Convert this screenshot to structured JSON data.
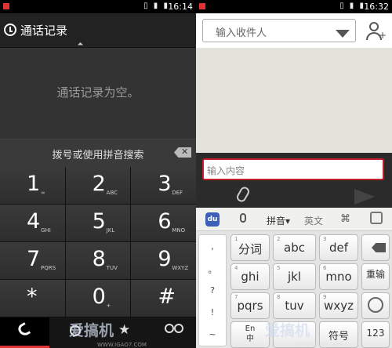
{
  "left": {
    "status_time": "16:14",
    "header_title": "通话记录",
    "empty_text": "通话记录为空。",
    "search_hint": "拨号或使用拼音搜索",
    "keys": [
      {
        "digit": "1",
        "letters": "∞"
      },
      {
        "digit": "2",
        "letters": "ABC"
      },
      {
        "digit": "3",
        "letters": "DEF"
      },
      {
        "digit": "4",
        "letters": "GHI"
      },
      {
        "digit": "5",
        "letters": "JKL"
      },
      {
        "digit": "6",
        "letters": "MNO"
      },
      {
        "digit": "7",
        "letters": "PQRS"
      },
      {
        "digit": "8",
        "letters": "TUV"
      },
      {
        "digit": "9",
        "letters": "WXYZ"
      },
      {
        "digit": "*",
        "letters": ""
      },
      {
        "digit": "0",
        "letters": "+"
      },
      {
        "digit": "#",
        "letters": ""
      }
    ],
    "backspace_symbol": "✕",
    "watermark": "爱搞机",
    "watermark_url": "WWW.IGAO7.COM"
  },
  "right": {
    "status_time": "16:32",
    "recipient_placeholder": "输入收件人",
    "message_placeholder": "输入内容",
    "ime": {
      "du": "du",
      "pinyin": "拼音▾",
      "english": "英文",
      "grid": "⌘"
    },
    "symbols": [
      ",",
      "。",
      "?",
      "!",
      "~"
    ],
    "rows": [
      [
        {
          "num": "1",
          "label": "分词"
        },
        {
          "num": "2",
          "label": "abc"
        },
        {
          "num": "3",
          "label": "def"
        }
      ],
      [
        {
          "num": "4",
          "label": "ghi"
        },
        {
          "num": "5",
          "label": "jkl"
        },
        {
          "num": "6",
          "label": "mno"
        }
      ],
      [
        {
          "num": "7",
          "label": "pqrs"
        },
        {
          "num": "8",
          "label": "tuv"
        },
        {
          "num": "9",
          "label": "wxyz"
        }
      ]
    ],
    "clear_label": "重输",
    "bottom": {
      "en": "En",
      "zh": "中",
      "symbol": "符号",
      "num": "123"
    },
    "watermark": "爱搞机",
    "watermark_url": "WWW.IGAO7.COM"
  },
  "colors": {
    "call_green": "#6cbf22",
    "accent_red": "#c0202a",
    "du_blue": "#3d5fb8"
  }
}
